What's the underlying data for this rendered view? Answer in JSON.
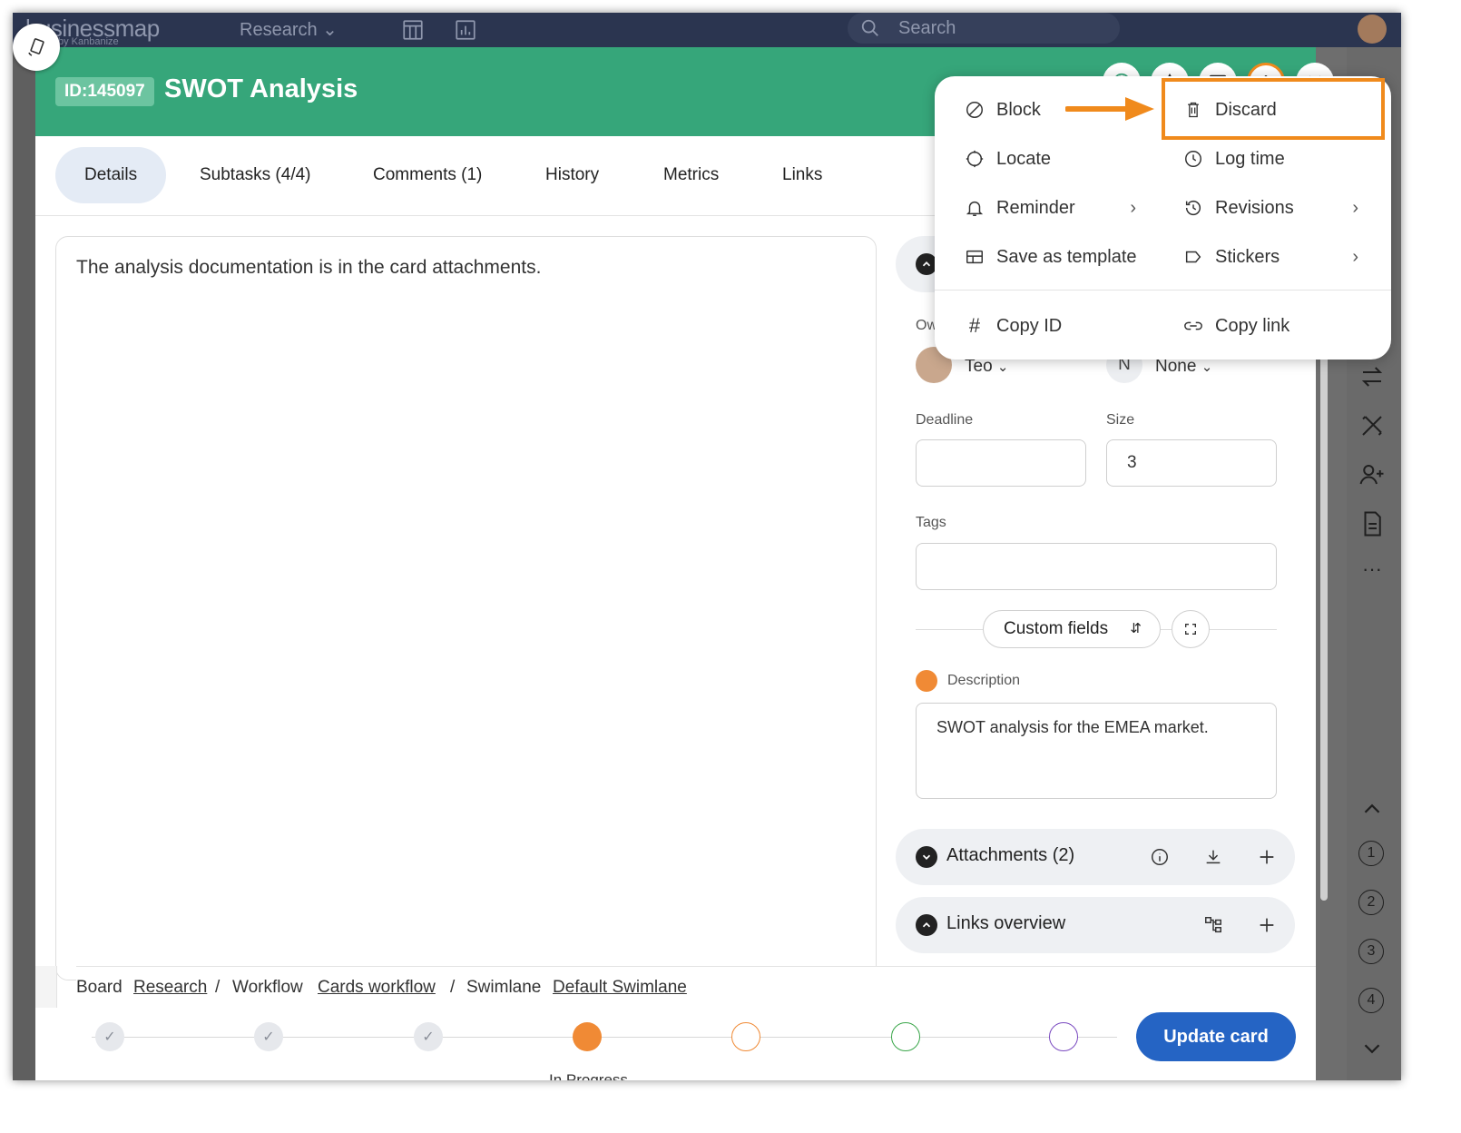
{
  "topbar": {
    "logo": "businessmap",
    "logo_sub": "by Kanbanize",
    "workspace": "Research",
    "search_placeholder": "Search"
  },
  "card": {
    "id_label": "ID:145097",
    "title": "SWOT Analysis"
  },
  "tabs": [
    {
      "label": "Details",
      "active": true
    },
    {
      "label": "Subtasks (4/4)"
    },
    {
      "label": "Comments (1)"
    },
    {
      "label": "History"
    },
    {
      "label": "Metrics"
    },
    {
      "label": "Links"
    }
  ],
  "details": {
    "text": "The analysis documentation is in the card attachments."
  },
  "side": {
    "owner_label": "Ow",
    "owner_name": "Teo",
    "co_owner_initial": "N",
    "co_owner_name": "None",
    "deadline_label": "Deadline",
    "deadline_value": "",
    "size_label": "Size",
    "size_value": "3",
    "tags_label": "Tags",
    "custom_fields_label": "Custom fields",
    "description_label": "Description",
    "description_value": "SWOT analysis for the EMEA market.",
    "attachments_label": "Attachments (2)",
    "links_overview_label": "Links overview"
  },
  "breadcrumb": {
    "board_label": "Board",
    "board_link": "Research",
    "workflow_label": "Workflow",
    "workflow_link": "Cards workflow",
    "swimlane_label": "Swimlane",
    "swimlane_link": "Default Swimlane",
    "separator": "/"
  },
  "progress": {
    "current_step_label": "In Progress",
    "update_button": "Update card"
  },
  "menu": {
    "items": [
      {
        "label": "Block",
        "icon": "block-icon"
      },
      {
        "label": "Discard",
        "icon": "trash-icon",
        "highlighted": true
      },
      {
        "label": "Locate",
        "icon": "locate-icon"
      },
      {
        "label": "Log time",
        "icon": "clock-icon"
      },
      {
        "label": "Reminder",
        "icon": "bell-icon",
        "submenu": true
      },
      {
        "label": "Revisions",
        "icon": "history-icon",
        "submenu": true
      },
      {
        "label": "Save as template",
        "icon": "template-icon"
      },
      {
        "label": "Stickers",
        "icon": "sticker-icon",
        "submenu": true
      },
      {
        "label": "Copy ID",
        "icon": "hash-icon"
      },
      {
        "label": "Copy link",
        "icon": "link-icon"
      }
    ]
  },
  "colors": {
    "header_green": "#36a67a",
    "highlight_orange": "#f08a1c",
    "primary_blue": "#2564c4"
  },
  "rail": {
    "steps": [
      "1",
      "2",
      "3",
      "4"
    ],
    "more": "···"
  }
}
